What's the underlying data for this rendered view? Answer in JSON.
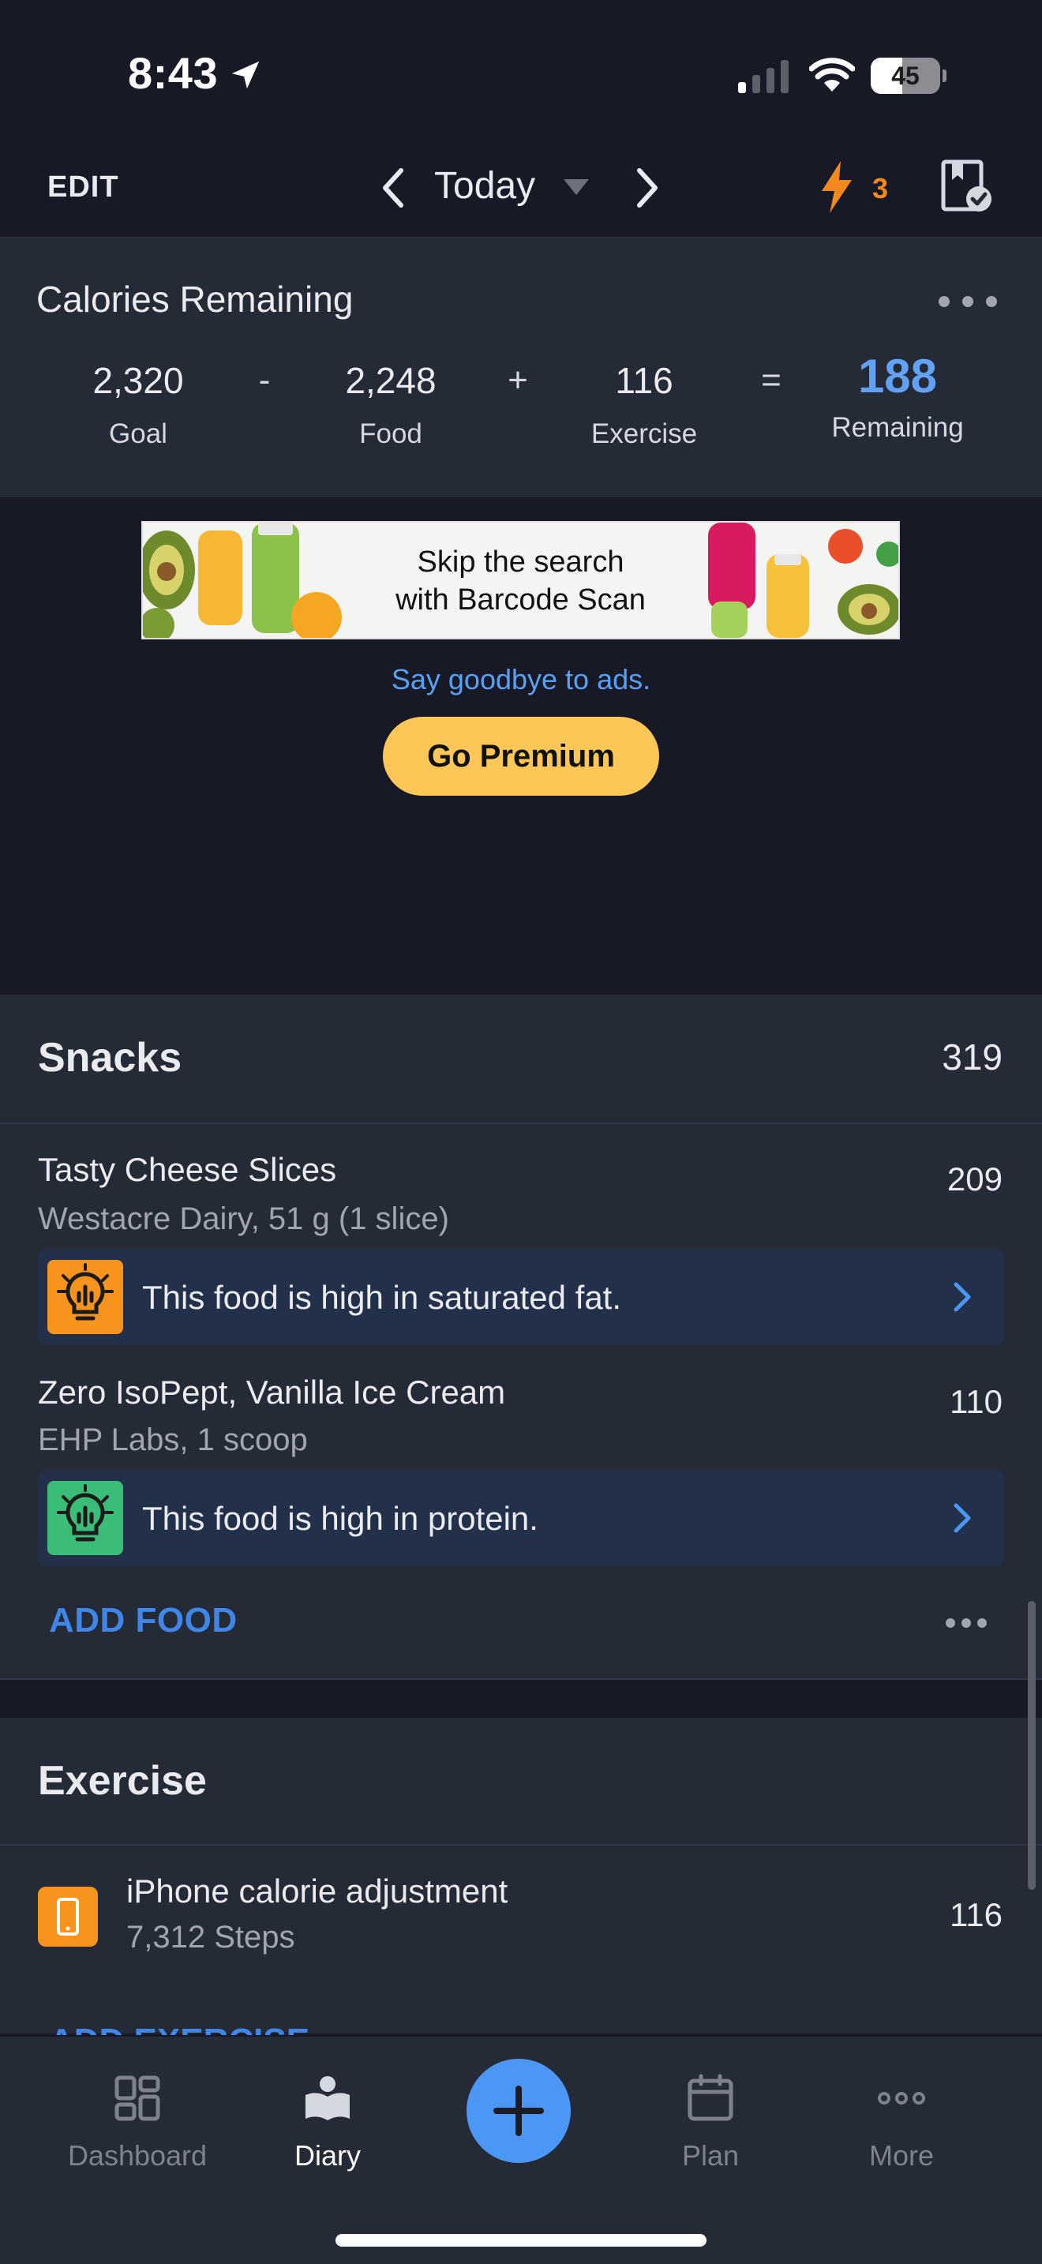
{
  "status_bar": {
    "time": "8:43",
    "battery_level": "45"
  },
  "nav": {
    "edit_label": "EDIT",
    "date_label": "Today",
    "streak_count": "3"
  },
  "calories": {
    "title": "Calories Remaining",
    "goal_value": "2,320",
    "goal_label": "Goal",
    "food_value": "2,248",
    "food_label": "Food",
    "exercise_value": "116",
    "exercise_label": "Exercise",
    "remaining_value": "188",
    "remaining_label": "Remaining",
    "op_minus": "-",
    "op_plus": "+",
    "op_equals": "="
  },
  "ad": {
    "line1": "Skip the search",
    "line2": "with Barcode Scan",
    "remove_ads_text": "Say goodbye to ads.",
    "premium_button": "Go Premium"
  },
  "snacks": {
    "title": "Snacks",
    "total": "319",
    "items": [
      {
        "name": "Tasty Cheese Slices",
        "detail": "Westacre Dairy, 51 g (1 slice)",
        "calories": "209",
        "insight": "This food is high in saturated fat.",
        "insight_color": "#f7941d"
      },
      {
        "name": "Zero IsoPept, Vanilla Ice Cream",
        "detail": "EHP Labs, 1 scoop",
        "calories": "110",
        "insight": "This food is high in protein.",
        "insight_color": "#3bbd7a"
      }
    ],
    "add_label": "ADD FOOD"
  },
  "exercise": {
    "title": "Exercise",
    "items": [
      {
        "name": "iPhone calorie adjustment",
        "detail": "7,312 Steps",
        "calories": "116"
      }
    ],
    "add_label": "ADD EXERCISE"
  },
  "tabs": [
    {
      "label": "Dashboard",
      "icon": "dashboard-icon"
    },
    {
      "label": "Diary",
      "icon": "diary-icon",
      "active": true
    },
    {
      "label": "",
      "icon": "plus-icon"
    },
    {
      "label": "Plan",
      "icon": "calendar-icon"
    },
    {
      "label": "More",
      "icon": "more-icon"
    }
  ],
  "colors": {
    "accent": "#4b97f3",
    "remaining": "#62a2f4",
    "premium": "#fdc757",
    "streak": "#f2891e"
  }
}
